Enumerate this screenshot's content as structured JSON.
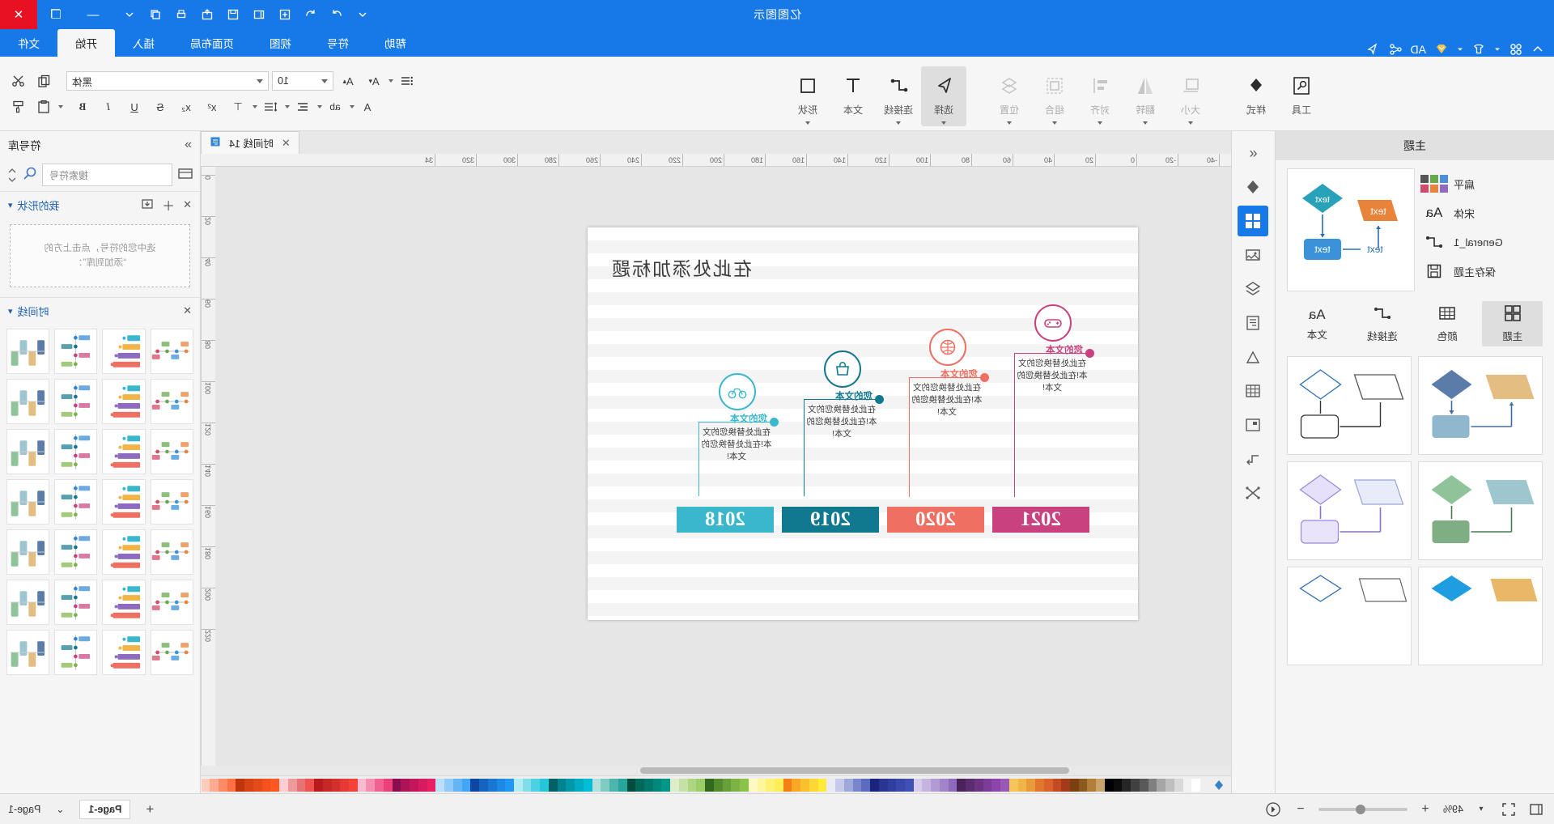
{
  "window": {
    "title": "亿图图示",
    "controls": {
      "close": "✕",
      "maximize": "❐",
      "minimize": "—"
    }
  },
  "quick_access": {
    "items": [
      {
        "name": "collapse-ribbon-icon",
        "glyph": "⌃"
      },
      {
        "name": "apps-grid-icon",
        "glyph": "▦"
      },
      {
        "name": "theme-shirt-icon",
        "glyph": "♚"
      },
      {
        "name": "diamond-badge-icon",
        "glyph": "◆"
      },
      {
        "name": "ad-label",
        "glyph": "AD"
      },
      {
        "name": "share-nodes-icon",
        "glyph": "⤳"
      },
      {
        "name": "cursor-pointer-icon",
        "glyph": "➤"
      }
    ],
    "right_items": [
      {
        "name": "chevron-down-icon",
        "glyph": "⌄"
      },
      {
        "name": "window-restore-icon",
        "glyph": "❐"
      },
      {
        "name": "print-icon",
        "glyph": "🖶"
      },
      {
        "name": "export-icon",
        "glyph": "⇪"
      },
      {
        "name": "save-icon",
        "glyph": "💾"
      },
      {
        "name": "open-icon",
        "glyph": "📂"
      },
      {
        "name": "new-icon",
        "glyph": "＋"
      },
      {
        "name": "undo-icon",
        "glyph": "↺"
      },
      {
        "name": "redo-icon",
        "glyph": "↻"
      }
    ]
  },
  "ribbon_tabs": [
    {
      "label": "文件",
      "active": false
    },
    {
      "label": "开始",
      "active": true
    },
    {
      "label": "插入",
      "active": false
    },
    {
      "label": "页面布局",
      "active": false
    },
    {
      "label": "视图",
      "active": false
    },
    {
      "label": "符号",
      "active": false
    },
    {
      "label": "帮助",
      "active": false
    }
  ],
  "ribbon": {
    "groups": [
      {
        "name": "clipboard",
        "buttons": [
          {
            "label": "粘贴",
            "icon": "clipboard-icon",
            "dropdown": false,
            "dim": false
          },
          {
            "label": "复制",
            "icon": "copy-icon",
            "dropdown": false,
            "dim": false
          },
          {
            "label": "剪切",
            "icon": "scissors-icon",
            "dropdown": false,
            "dim": false
          },
          {
            "label": "格式刷",
            "icon": "format-painter-icon",
            "dropdown": false,
            "dim": false
          }
        ]
      },
      {
        "name": "shape-tools",
        "buttons": [
          {
            "label": "选择",
            "icon": "pointer-icon",
            "dropdown": true,
            "dim": false,
            "active": true
          },
          {
            "label": "连接线",
            "icon": "connector-icon",
            "dropdown": true,
            "dim": false
          },
          {
            "label": "文本",
            "icon": "text-icon",
            "dropdown": false,
            "dim": false
          },
          {
            "label": "形状",
            "icon": "shape-icon",
            "dropdown": true,
            "dim": false
          }
        ]
      },
      {
        "name": "arrange",
        "buttons": [
          {
            "label": "大小",
            "icon": "size-icon",
            "dropdown": true,
            "dim": true
          },
          {
            "label": "翻转",
            "icon": "flip-icon",
            "dropdown": true,
            "dim": true
          },
          {
            "label": "对齐",
            "icon": "align-icon",
            "dropdown": true,
            "dim": true
          },
          {
            "label": "组合",
            "icon": "group-icon",
            "dropdown": true,
            "dim": true
          },
          {
            "label": "位置",
            "icon": "position-icon",
            "dropdown": true,
            "dim": true
          }
        ]
      },
      {
        "name": "style",
        "buttons": [
          {
            "label": "样式",
            "icon": "fill-bucket-icon",
            "dropdown": false,
            "dim": false
          },
          {
            "label": "工具",
            "icon": "tools-icon",
            "dropdown": false,
            "dim": false
          }
        ]
      }
    ],
    "font": {
      "family_value": "黑体",
      "size_value": "10",
      "format_icons_row1": [
        "减小字号",
        "增大字号",
        "字体颜色",
        "项目符号"
      ],
      "format_icons_row2": [
        "加粗",
        "倾斜",
        "下划线",
        "删除线",
        "上标",
        "下标",
        "行距",
        "对齐",
        "文本方向",
        "字符间距",
        "字体"
      ]
    }
  },
  "left_panel": {
    "title": "主题",
    "properties": [
      {
        "label": "扁平",
        "icon": "color-swatch-icon"
      },
      {
        "label": "宋体",
        "icon": "font-aa-icon"
      },
      {
        "label": "General_1",
        "icon": "connector-style-icon"
      },
      {
        "label": "保存主题",
        "icon": "save-theme-icon"
      }
    ],
    "tabs": [
      {
        "label": "主题",
        "icon": "theme-grid-icon",
        "active": true
      },
      {
        "label": "颜色",
        "icon": "color-table-icon",
        "active": false
      },
      {
        "label": "连接线",
        "icon": "connector-icon",
        "active": false
      },
      {
        "label": "文本",
        "icon": "font-aa-icon",
        "active": false
      }
    ],
    "preview_text": "text"
  },
  "icon_strip": [
    {
      "name": "shuffle-icon",
      "glyph": "⤬",
      "active": false
    },
    {
      "name": "flow-icon",
      "glyph": "⇥",
      "active": false
    },
    {
      "name": "table-icon",
      "glyph": "▦",
      "active": false
    },
    {
      "name": "grid-icon",
      "glyph": "▤",
      "active": false
    },
    {
      "name": "chart-icon",
      "glyph": "◺",
      "active": false
    },
    {
      "name": "document-icon",
      "glyph": "▤",
      "active": false
    },
    {
      "name": "layers-icon",
      "glyph": "◈",
      "active": false
    },
    {
      "name": "image-icon",
      "glyph": "▣",
      "active": false
    },
    {
      "name": "theme-panel-icon",
      "glyph": "▩",
      "active": true
    },
    {
      "name": "fill-icon",
      "glyph": "◆",
      "active": false
    },
    {
      "name": "collapse-panel-icon",
      "glyph": "«",
      "active": false
    }
  ],
  "document": {
    "tab_label": "时间线 14",
    "tab_close": "✕",
    "tab_icon": "page-icon",
    "ruler_h_ticks": [
      "-40",
      "-20",
      "0",
      "20",
      "40",
      "60",
      "80",
      "100",
      "120",
      "140",
      "160",
      "180",
      "200",
      "220",
      "240",
      "260",
      "280",
      "300",
      "320",
      "34"
    ],
    "ruler_v_ticks": [
      "0",
      "20",
      "40",
      "60",
      "80",
      "100",
      "120",
      "140",
      "160",
      "180",
      "200",
      "220"
    ]
  },
  "diagram": {
    "title": "在此处添加标题",
    "body_text": "在此处替换您的文本!在此处替换您的文本!",
    "head_text": "您的文本",
    "milestones": [
      {
        "year": "2021",
        "color": "#c9417e",
        "icon": "gamepad-icon"
      },
      {
        "year": "2020",
        "color": "#ef6f62",
        "icon": "basketball-icon"
      },
      {
        "year": "2019",
        "color": "#10788f",
        "icon": "handbag-icon"
      },
      {
        "year": "2018",
        "color": "#3ab7cd",
        "icon": "bicycle-icon"
      }
    ]
  },
  "right_panel": {
    "title": "符号库",
    "collapse_icon": "»",
    "search_placeholder": "搜索符号",
    "search_icon": "search-icon",
    "library_icon": "library-icon",
    "sections": [
      {
        "title": "我的形状",
        "icons": [
          "import-icon",
          "add-icon",
          "close-icon"
        ],
        "drop_hint": "选中您的符号，点击上方的\n“添加到库”："
      },
      {
        "title": "时间线",
        "icons": [
          "close-icon"
        ]
      }
    ]
  },
  "status_bar": {
    "page_label": "Page-1",
    "page_tab": "Page-1",
    "add_page": "+",
    "dropdown": "⌄",
    "zoom_value": "49%",
    "zoom_out": "−",
    "zoom_in": "+",
    "prev_icon": "◀",
    "fit_icon": "⛶",
    "fullscreen_icon": "⊡"
  },
  "palette": {
    "colors": [
      "#ffffff",
      "#f2f2f2",
      "#d9d9d9",
      "#bfbfbf",
      "#a6a6a6",
      "#808080",
      "#595959",
      "#404040",
      "#262626",
      "#0d0d0d",
      "#000000",
      "#c9a46a",
      "#b07f3a",
      "#8a5a1e",
      "#7b3f12",
      "#a33a1a",
      "#c24a20",
      "#d9622a",
      "#e0772f",
      "#e89b3c",
      "#f0b447",
      "#f5c55a",
      "#9b59b6",
      "#8e44ad",
      "#7d3c98",
      "#6c3483",
      "#5b2c6f",
      "#4a235a",
      "#8e6bbf",
      "#a083c9",
      "#b29bd4",
      "#c5b3e0",
      "#d7cbeb",
      "#3f51b5",
      "#3949ab",
      "#303f9f",
      "#283593",
      "#1a237e",
      "#5c6bc0",
      "#7986cb",
      "#9fa8da",
      "#c5cae9",
      "#e8eaf6",
      "#ffeb3b",
      "#fdd835",
      "#fbc02d",
      "#f9a825",
      "#f57f17",
      "#ffee58",
      "#fff176",
      "#fff59d",
      "#fff9c4",
      "#8bc34a",
      "#7cb342",
      "#689f38",
      "#558b2f",
      "#33691e",
      "#9ccc65",
      "#aed581",
      "#c5e1a5",
      "#dcedc8",
      "#009688",
      "#00897b",
      "#00796b",
      "#00695c",
      "#004d40",
      "#26a69a",
      "#4db6ac",
      "#80cbc4",
      "#b2dfdb",
      "#00bcd4",
      "#00acc1",
      "#0097a7",
      "#00838f",
      "#006064",
      "#26c6da",
      "#4dd0e1",
      "#80deea",
      "#b2ebf2",
      "#2196f3",
      "#1e88e5",
      "#1976d2",
      "#1565c0",
      "#0d47a1",
      "#42a5f5",
      "#64b5f6",
      "#90caf9",
      "#bbdefb",
      "#e91e63",
      "#d81b60",
      "#c2185b",
      "#ad1457",
      "#880e4f",
      "#ec407a",
      "#f06292",
      "#f48fb1",
      "#f8bbd0",
      "#f44336",
      "#e53935",
      "#d32f2f",
      "#c62828",
      "#b71c1c",
      "#ef5350",
      "#e57373",
      "#ef9a9a",
      "#ffcdd2",
      "#ff5722",
      "#f4511e",
      "#e64a19",
      "#d84315",
      "#bf360c",
      "#ff7043",
      "#ff8a65",
      "#ffab91",
      "#ffccbc"
    ]
  }
}
